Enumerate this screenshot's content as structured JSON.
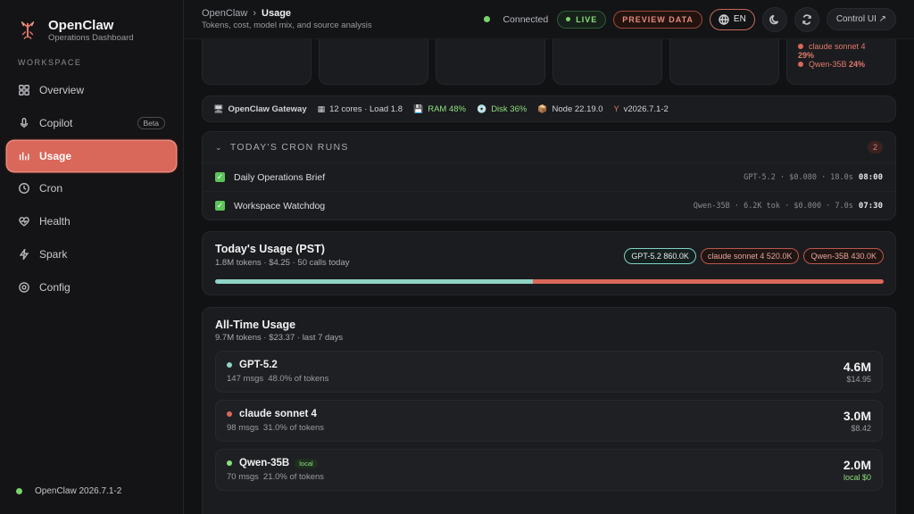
{
  "app": {
    "name": "OpenClaw",
    "subtitle": "Operations Dashboard"
  },
  "sidebar": {
    "section_label": "WORKSPACE",
    "items": [
      {
        "label": "Overview",
        "icon": "grid-icon"
      },
      {
        "label": "Copilot",
        "icon": "mic-icon",
        "badge": "Beta"
      },
      {
        "label": "Usage",
        "icon": "bar-chart-icon",
        "active": true
      },
      {
        "label": "Cron",
        "icon": "clock-icon"
      },
      {
        "label": "Health",
        "icon": "heart-icon"
      },
      {
        "label": "Spark",
        "icon": "bolt-icon"
      },
      {
        "label": "Config",
        "icon": "settings-icon"
      }
    ],
    "footer_version": "OpenClaw 2026.7.1-2"
  },
  "header": {
    "breadcrumb_root": "OpenClaw",
    "breadcrumb_sep": "›",
    "breadcrumb_current": "Usage",
    "subtitle": "Tokens, cost, model mix, and source analysis",
    "status": "Connected",
    "live_label": "LIVE",
    "preview_label": "PREVIEW DATA",
    "lang_label": "EN",
    "control_label": "Control UI ↗"
  },
  "mix_legend": [
    {
      "name": "claude sonnet 4",
      "pct": "29%"
    },
    {
      "name": "Qwen-35B",
      "pct": "24%"
    }
  ],
  "system": {
    "gateway": "OpenClaw Gateway",
    "cpu": "12 cores · Load 1.8",
    "ram": "RAM 48%",
    "disk": "Disk 36%",
    "node": "Node 22.19.0",
    "version": "v2026.7.1-2"
  },
  "cron": {
    "title": "TODAY'S CRON RUNS",
    "count": "2",
    "runs": [
      {
        "name": "Daily Operations Brief",
        "meta": "GPT-5.2 · $0.080 · 18.0s",
        "time": "08:00"
      },
      {
        "name": "Workspace Watchdog",
        "meta": "Qwen-35B · 6.2K tok · $0.000 · 7.0s",
        "time": "07:30"
      }
    ]
  },
  "today": {
    "title": "Today's Usage (PST)",
    "summary": "1.8M tokens · $4.25 · 50 calls today",
    "chips": [
      {
        "label": "GPT-5.2 860.0K",
        "style": "teal"
      },
      {
        "label": "claude sonnet 4 520.0K",
        "style": "red"
      },
      {
        "label": "Qwen-35B 430.0K",
        "style": "red"
      }
    ],
    "bar": [
      {
        "value": 860.0,
        "color": "#8fd3c7"
      },
      {
        "value": 520.0,
        "color": "#d9685a"
      },
      {
        "value": 430.0,
        "color": "#d9685a"
      }
    ]
  },
  "alltime": {
    "title": "All-Time Usage",
    "summary": "9.7M tokens · $23.37 · last 7 days",
    "models": [
      {
        "name": "GPT-5.2",
        "msgs": "147 msgs",
        "share": "48.0% of tokens",
        "tokens": "4.6M",
        "cost": "$14.95",
        "color": "#8fd3c7"
      },
      {
        "name": "claude sonnet 4",
        "msgs": "98 msgs",
        "share": "31.0% of tokens",
        "tokens": "3.0M",
        "cost": "$8.42",
        "color": "#d9685a"
      },
      {
        "name": "Qwen-35B",
        "msgs": "70 msgs",
        "share": "21.0% of tokens",
        "tokens": "2.0M",
        "cost": "local $0",
        "color": "#8ddf7e",
        "tag": "local"
      }
    ]
  }
}
